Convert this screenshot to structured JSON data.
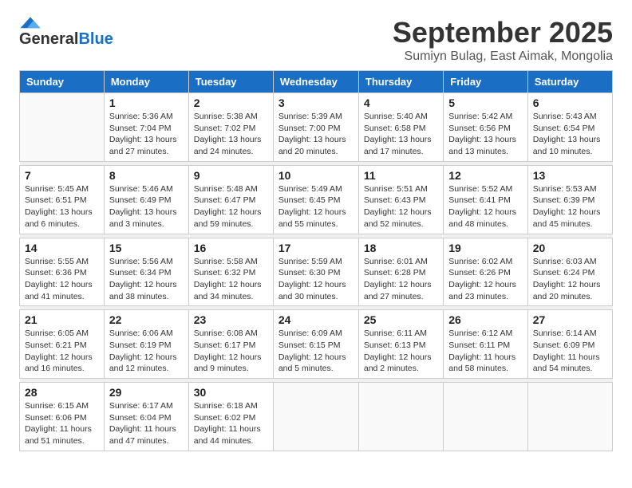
{
  "logo": {
    "general": "General",
    "blue": "Blue"
  },
  "title": {
    "month": "September 2025",
    "location": "Sumiyn Bulag, East Aimak, Mongolia"
  },
  "weekdays": [
    "Sunday",
    "Monday",
    "Tuesday",
    "Wednesday",
    "Thursday",
    "Friday",
    "Saturday"
  ],
  "weeks": [
    [
      {
        "day": null,
        "sunrise": null,
        "sunset": null,
        "daylight": null
      },
      {
        "day": "1",
        "sunrise": "Sunrise: 5:36 AM",
        "sunset": "Sunset: 7:04 PM",
        "daylight": "Daylight: 13 hours and 27 minutes."
      },
      {
        "day": "2",
        "sunrise": "Sunrise: 5:38 AM",
        "sunset": "Sunset: 7:02 PM",
        "daylight": "Daylight: 13 hours and 24 minutes."
      },
      {
        "day": "3",
        "sunrise": "Sunrise: 5:39 AM",
        "sunset": "Sunset: 7:00 PM",
        "daylight": "Daylight: 13 hours and 20 minutes."
      },
      {
        "day": "4",
        "sunrise": "Sunrise: 5:40 AM",
        "sunset": "Sunset: 6:58 PM",
        "daylight": "Daylight: 13 hours and 17 minutes."
      },
      {
        "day": "5",
        "sunrise": "Sunrise: 5:42 AM",
        "sunset": "Sunset: 6:56 PM",
        "daylight": "Daylight: 13 hours and 13 minutes."
      },
      {
        "day": "6",
        "sunrise": "Sunrise: 5:43 AM",
        "sunset": "Sunset: 6:54 PM",
        "daylight": "Daylight: 13 hours and 10 minutes."
      }
    ],
    [
      {
        "day": "7",
        "sunrise": "Sunrise: 5:45 AM",
        "sunset": "Sunset: 6:51 PM",
        "daylight": "Daylight: 13 hours and 6 minutes."
      },
      {
        "day": "8",
        "sunrise": "Sunrise: 5:46 AM",
        "sunset": "Sunset: 6:49 PM",
        "daylight": "Daylight: 13 hours and 3 minutes."
      },
      {
        "day": "9",
        "sunrise": "Sunrise: 5:48 AM",
        "sunset": "Sunset: 6:47 PM",
        "daylight": "Daylight: 12 hours and 59 minutes."
      },
      {
        "day": "10",
        "sunrise": "Sunrise: 5:49 AM",
        "sunset": "Sunset: 6:45 PM",
        "daylight": "Daylight: 12 hours and 55 minutes."
      },
      {
        "day": "11",
        "sunrise": "Sunrise: 5:51 AM",
        "sunset": "Sunset: 6:43 PM",
        "daylight": "Daylight: 12 hours and 52 minutes."
      },
      {
        "day": "12",
        "sunrise": "Sunrise: 5:52 AM",
        "sunset": "Sunset: 6:41 PM",
        "daylight": "Daylight: 12 hours and 48 minutes."
      },
      {
        "day": "13",
        "sunrise": "Sunrise: 5:53 AM",
        "sunset": "Sunset: 6:39 PM",
        "daylight": "Daylight: 12 hours and 45 minutes."
      }
    ],
    [
      {
        "day": "14",
        "sunrise": "Sunrise: 5:55 AM",
        "sunset": "Sunset: 6:36 PM",
        "daylight": "Daylight: 12 hours and 41 minutes."
      },
      {
        "day": "15",
        "sunrise": "Sunrise: 5:56 AM",
        "sunset": "Sunset: 6:34 PM",
        "daylight": "Daylight: 12 hours and 38 minutes."
      },
      {
        "day": "16",
        "sunrise": "Sunrise: 5:58 AM",
        "sunset": "Sunset: 6:32 PM",
        "daylight": "Daylight: 12 hours and 34 minutes."
      },
      {
        "day": "17",
        "sunrise": "Sunrise: 5:59 AM",
        "sunset": "Sunset: 6:30 PM",
        "daylight": "Daylight: 12 hours and 30 minutes."
      },
      {
        "day": "18",
        "sunrise": "Sunrise: 6:01 AM",
        "sunset": "Sunset: 6:28 PM",
        "daylight": "Daylight: 12 hours and 27 minutes."
      },
      {
        "day": "19",
        "sunrise": "Sunrise: 6:02 AM",
        "sunset": "Sunset: 6:26 PM",
        "daylight": "Daylight: 12 hours and 23 minutes."
      },
      {
        "day": "20",
        "sunrise": "Sunrise: 6:03 AM",
        "sunset": "Sunset: 6:24 PM",
        "daylight": "Daylight: 12 hours and 20 minutes."
      }
    ],
    [
      {
        "day": "21",
        "sunrise": "Sunrise: 6:05 AM",
        "sunset": "Sunset: 6:21 PM",
        "daylight": "Daylight: 12 hours and 16 minutes."
      },
      {
        "day": "22",
        "sunrise": "Sunrise: 6:06 AM",
        "sunset": "Sunset: 6:19 PM",
        "daylight": "Daylight: 12 hours and 12 minutes."
      },
      {
        "day": "23",
        "sunrise": "Sunrise: 6:08 AM",
        "sunset": "Sunset: 6:17 PM",
        "daylight": "Daylight: 12 hours and 9 minutes."
      },
      {
        "day": "24",
        "sunrise": "Sunrise: 6:09 AM",
        "sunset": "Sunset: 6:15 PM",
        "daylight": "Daylight: 12 hours and 5 minutes."
      },
      {
        "day": "25",
        "sunrise": "Sunrise: 6:11 AM",
        "sunset": "Sunset: 6:13 PM",
        "daylight": "Daylight: 12 hours and 2 minutes."
      },
      {
        "day": "26",
        "sunrise": "Sunrise: 6:12 AM",
        "sunset": "Sunset: 6:11 PM",
        "daylight": "Daylight: 11 hours and 58 minutes."
      },
      {
        "day": "27",
        "sunrise": "Sunrise: 6:14 AM",
        "sunset": "Sunset: 6:09 PM",
        "daylight": "Daylight: 11 hours and 54 minutes."
      }
    ],
    [
      {
        "day": "28",
        "sunrise": "Sunrise: 6:15 AM",
        "sunset": "Sunset: 6:06 PM",
        "daylight": "Daylight: 11 hours and 51 minutes."
      },
      {
        "day": "29",
        "sunrise": "Sunrise: 6:17 AM",
        "sunset": "Sunset: 6:04 PM",
        "daylight": "Daylight: 11 hours and 47 minutes."
      },
      {
        "day": "30",
        "sunrise": "Sunrise: 6:18 AM",
        "sunset": "Sunset: 6:02 PM",
        "daylight": "Daylight: 11 hours and 44 minutes."
      },
      {
        "day": null,
        "sunrise": null,
        "sunset": null,
        "daylight": null
      },
      {
        "day": null,
        "sunrise": null,
        "sunset": null,
        "daylight": null
      },
      {
        "day": null,
        "sunrise": null,
        "sunset": null,
        "daylight": null
      },
      {
        "day": null,
        "sunrise": null,
        "sunset": null,
        "daylight": null
      }
    ]
  ]
}
